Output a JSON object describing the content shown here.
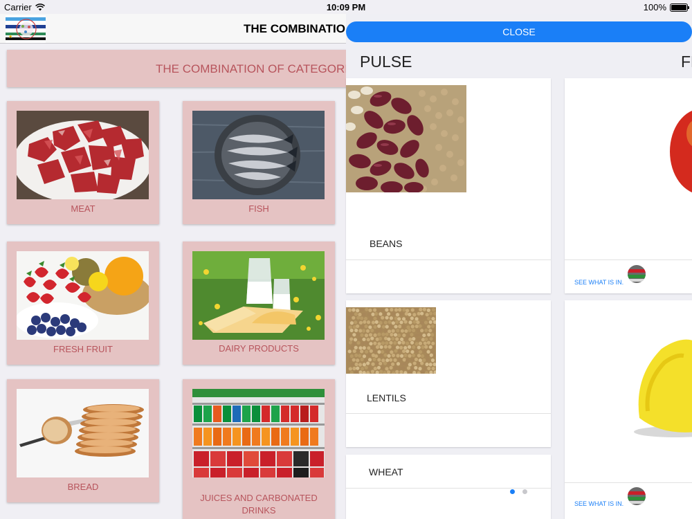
{
  "status_bar": {
    "carrier": "Carrier",
    "time": "10:09 PM",
    "battery": "100%",
    "battery_level": 1.0
  },
  "nav": {
    "title": "THE COMBINATION OF CATEGORIES"
  },
  "banner": {
    "text": "THE COMBINATION OF CATEGORIES"
  },
  "categories": [
    {
      "label": "MEAT",
      "icon": "meat-photo"
    },
    {
      "label": "FISH",
      "icon": "fish-photo"
    },
    {
      "label": "FRESH FRUIT",
      "icon": "fruit-photo"
    },
    {
      "label": "DAIRY PRODUCTS",
      "icon": "dairy-photo"
    },
    {
      "label": "BREAD",
      "icon": "bread-photo"
    },
    {
      "label": "JUICES AND CARBONATED DRINKS",
      "icon": "drinks-photo"
    }
  ],
  "sheet": {
    "close_label": "CLOSE",
    "pulse": {
      "title": "PULSE",
      "items": [
        {
          "name": "BEANS"
        },
        {
          "name": "LENTILS"
        },
        {
          "name": "WHEAT"
        }
      ]
    },
    "fruit": {
      "title": "FRUIT",
      "see_link": "SEE WHAT IS IN."
    },
    "page_indicator": {
      "pages": 2,
      "current": 1
    }
  },
  "colors": {
    "card_bg": "#e5c3c3",
    "card_text": "#b7545c",
    "accent": "#1a7ff7"
  }
}
